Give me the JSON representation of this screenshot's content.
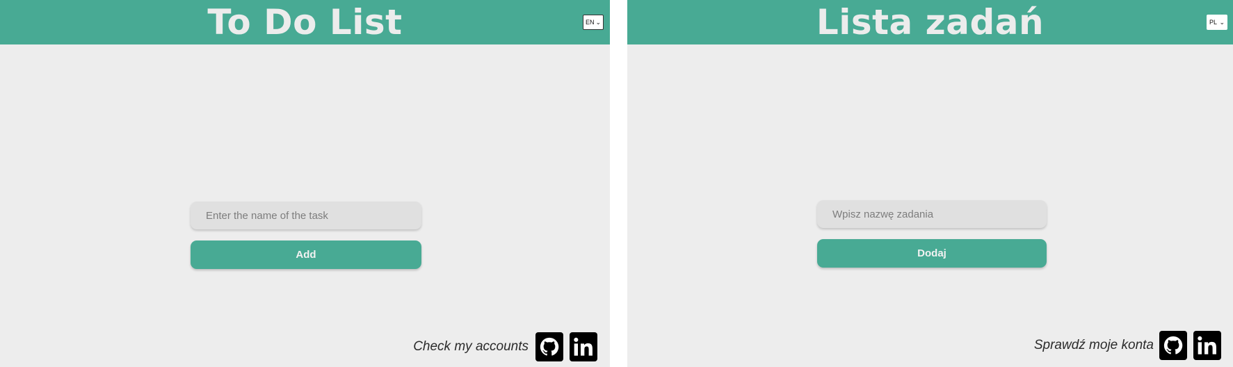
{
  "panels": {
    "en": {
      "title": "To Do List",
      "language": "EN",
      "input_placeholder": "Enter the name of the task",
      "add_button_label": "Add",
      "accounts_text": "Check my accounts"
    },
    "pl": {
      "title": "Lista zadań",
      "language": "PL",
      "input_placeholder": "Wpisz nazwę zadania",
      "add_button_label": "Dodaj",
      "accounts_text": "Sprawdź moje konta"
    }
  },
  "icons": {
    "social": [
      "github-icon",
      "linkedin-icon"
    ],
    "language_dropdown": "chevron-down-icon"
  },
  "colors": {
    "accent": "#48aa94",
    "background": "#ededed",
    "input_background": "#e0e0e0",
    "header_text": "#ececec"
  }
}
